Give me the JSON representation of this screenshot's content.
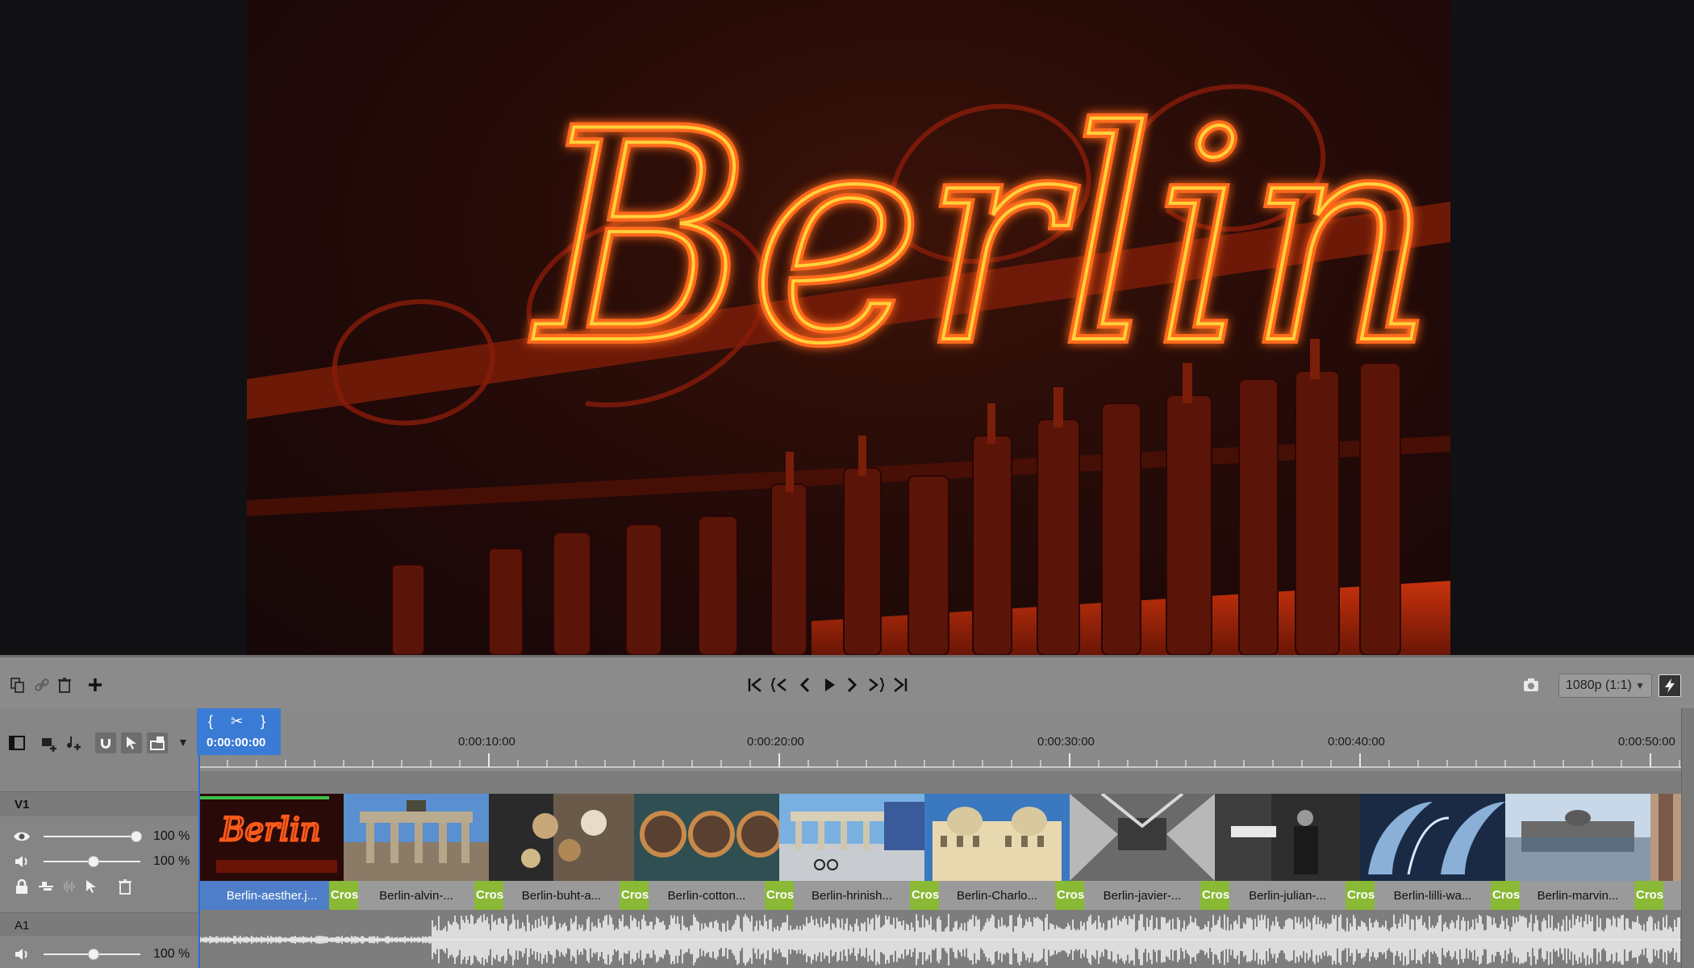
{
  "transport": {
    "quality": "1080p (1:1)",
    "buttons": [
      "go-to-start",
      "previous-marker",
      "previous-frame",
      "play",
      "next-frame",
      "next-marker",
      "go-to-end"
    ]
  },
  "playhead": {
    "time": "0:00:00:00"
  },
  "ruler": {
    "labels": [
      "0:00:10:00",
      "0:00:20:00",
      "0:00:30:00",
      "0:00:40:00",
      "0:00:50:00"
    ]
  },
  "tracks": {
    "v1": {
      "name": "V1",
      "opacity": "100 %",
      "volume": "100 %"
    },
    "a1": {
      "name": "A1",
      "volume": "100 %"
    }
  },
  "clips": [
    {
      "label": "Berlin-aesther.j...",
      "thumb": "neon-berlin",
      "selected": true
    },
    {
      "label": "Berlin-alvin-...",
      "thumb": "brandenburg"
    },
    {
      "label": "Berlin-buht-a...",
      "thumb": "pretzels"
    },
    {
      "label": "Berlin-cotton...",
      "thumb": "mirrors"
    },
    {
      "label": "Berlin-hrinish...",
      "thumb": "brandenburg-cyclists"
    },
    {
      "label": "Berlin-Charlo...",
      "thumb": "palace"
    },
    {
      "label": "Berlin-javier-...",
      "thumb": "subway"
    },
    {
      "label": "Berlin-julian-...",
      "thumb": "street-man"
    },
    {
      "label": "Berlin-lilli-wa...",
      "thumb": "dome-glass"
    },
    {
      "label": "Berlin-marvin...",
      "thumb": "reichstag-reflection"
    }
  ],
  "transition_label": "Cross",
  "colors": {
    "accent": "#3a7bd5",
    "transition": "#8ab936",
    "selection": "#3ec24a",
    "neon": "#ff6a1a"
  }
}
